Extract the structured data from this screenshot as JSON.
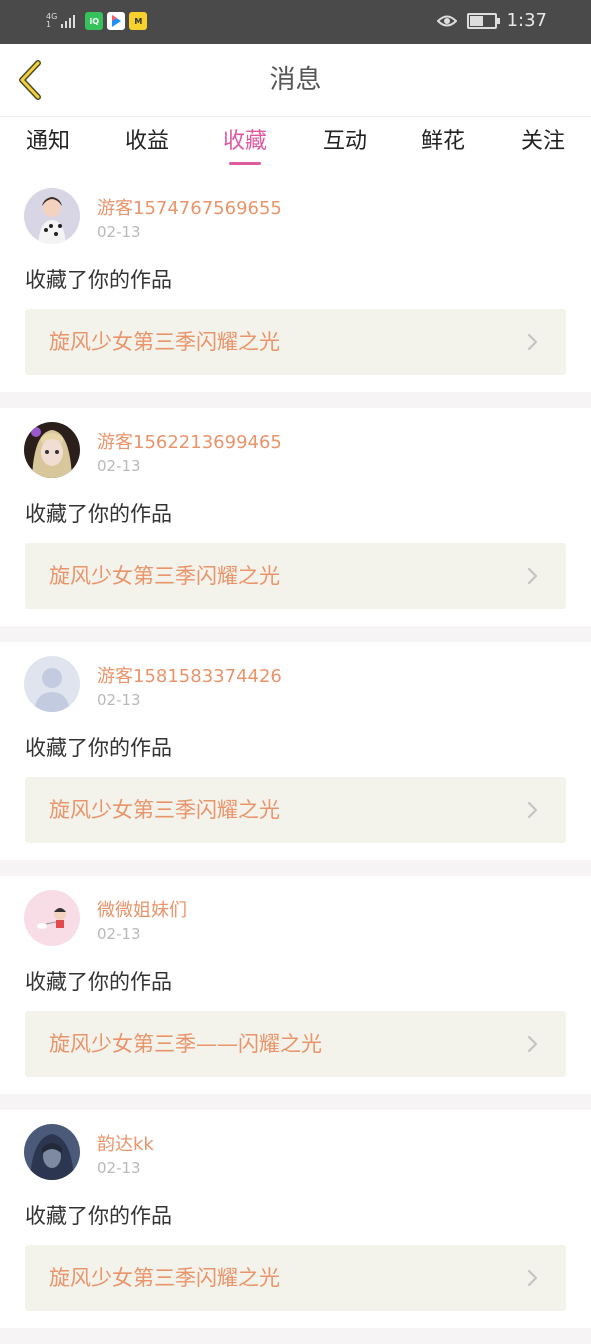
{
  "status_bar": {
    "network": "4G",
    "sim": "1",
    "apps": [
      "爱奇艺",
      "视频",
      "漫画"
    ],
    "time": "1:37",
    "battery_level": 0.6
  },
  "header": {
    "title": "消息"
  },
  "tabs": [
    {
      "label": "通知",
      "active": false
    },
    {
      "label": "收益",
      "active": false
    },
    {
      "label": "收藏",
      "active": true
    },
    {
      "label": "互动",
      "active": false
    },
    {
      "label": "鲜花",
      "active": false
    },
    {
      "label": "关注",
      "active": false
    }
  ],
  "colors": {
    "accent": "#e05aa0",
    "username": "#e9946a",
    "work_bg": "#f3f3ec",
    "status_bar": "#4a4a4a"
  },
  "feed": [
    {
      "username": "游客1574767569655",
      "date": "02-13",
      "action": "收藏了你的作品",
      "work": "旋风少女第三季闪耀之光",
      "avatar": "girl-photo"
    },
    {
      "username": "游客1562213699465",
      "date": "02-13",
      "action": "收藏了你的作品",
      "work": "旋风少女第三季闪耀之光",
      "avatar": "anime-doll"
    },
    {
      "username": "游客1581583374426",
      "date": "02-13",
      "action": "收藏了你的作品",
      "work": "旋风少女第三季闪耀之光",
      "avatar": "default-silhouette"
    },
    {
      "username": "微微姐妹们",
      "date": "02-13",
      "action": "收藏了你的作品",
      "work": "旋风少女第三季——闪耀之光",
      "avatar": "cartoon-kid"
    },
    {
      "username": "韵达kk",
      "date": "02-13",
      "action": "收藏了你的作品",
      "work": "旋风少女第三季闪耀之光",
      "avatar": "dark-hood"
    }
  ]
}
